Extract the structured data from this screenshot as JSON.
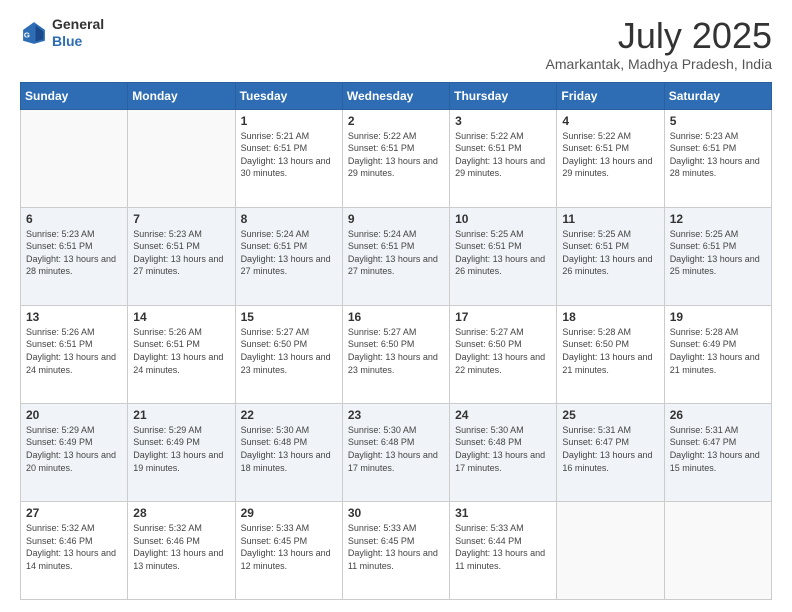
{
  "header": {
    "logo_line1": "General",
    "logo_line2": "Blue",
    "month_title": "July 2025",
    "location": "Amarkantak, Madhya Pradesh, India"
  },
  "days_of_week": [
    "Sunday",
    "Monday",
    "Tuesday",
    "Wednesday",
    "Thursday",
    "Friday",
    "Saturday"
  ],
  "weeks": [
    [
      {
        "day": "",
        "info": ""
      },
      {
        "day": "",
        "info": ""
      },
      {
        "day": "1",
        "info": "Sunrise: 5:21 AM\nSunset: 6:51 PM\nDaylight: 13 hours and 30 minutes."
      },
      {
        "day": "2",
        "info": "Sunrise: 5:22 AM\nSunset: 6:51 PM\nDaylight: 13 hours and 29 minutes."
      },
      {
        "day": "3",
        "info": "Sunrise: 5:22 AM\nSunset: 6:51 PM\nDaylight: 13 hours and 29 minutes."
      },
      {
        "day": "4",
        "info": "Sunrise: 5:22 AM\nSunset: 6:51 PM\nDaylight: 13 hours and 29 minutes."
      },
      {
        "day": "5",
        "info": "Sunrise: 5:23 AM\nSunset: 6:51 PM\nDaylight: 13 hours and 28 minutes."
      }
    ],
    [
      {
        "day": "6",
        "info": "Sunrise: 5:23 AM\nSunset: 6:51 PM\nDaylight: 13 hours and 28 minutes."
      },
      {
        "day": "7",
        "info": "Sunrise: 5:23 AM\nSunset: 6:51 PM\nDaylight: 13 hours and 27 minutes."
      },
      {
        "day": "8",
        "info": "Sunrise: 5:24 AM\nSunset: 6:51 PM\nDaylight: 13 hours and 27 minutes."
      },
      {
        "day": "9",
        "info": "Sunrise: 5:24 AM\nSunset: 6:51 PM\nDaylight: 13 hours and 27 minutes."
      },
      {
        "day": "10",
        "info": "Sunrise: 5:25 AM\nSunset: 6:51 PM\nDaylight: 13 hours and 26 minutes."
      },
      {
        "day": "11",
        "info": "Sunrise: 5:25 AM\nSunset: 6:51 PM\nDaylight: 13 hours and 26 minutes."
      },
      {
        "day": "12",
        "info": "Sunrise: 5:25 AM\nSunset: 6:51 PM\nDaylight: 13 hours and 25 minutes."
      }
    ],
    [
      {
        "day": "13",
        "info": "Sunrise: 5:26 AM\nSunset: 6:51 PM\nDaylight: 13 hours and 24 minutes."
      },
      {
        "day": "14",
        "info": "Sunrise: 5:26 AM\nSunset: 6:51 PM\nDaylight: 13 hours and 24 minutes."
      },
      {
        "day": "15",
        "info": "Sunrise: 5:27 AM\nSunset: 6:50 PM\nDaylight: 13 hours and 23 minutes."
      },
      {
        "day": "16",
        "info": "Sunrise: 5:27 AM\nSunset: 6:50 PM\nDaylight: 13 hours and 23 minutes."
      },
      {
        "day": "17",
        "info": "Sunrise: 5:27 AM\nSunset: 6:50 PM\nDaylight: 13 hours and 22 minutes."
      },
      {
        "day": "18",
        "info": "Sunrise: 5:28 AM\nSunset: 6:50 PM\nDaylight: 13 hours and 21 minutes."
      },
      {
        "day": "19",
        "info": "Sunrise: 5:28 AM\nSunset: 6:49 PM\nDaylight: 13 hours and 21 minutes."
      }
    ],
    [
      {
        "day": "20",
        "info": "Sunrise: 5:29 AM\nSunset: 6:49 PM\nDaylight: 13 hours and 20 minutes."
      },
      {
        "day": "21",
        "info": "Sunrise: 5:29 AM\nSunset: 6:49 PM\nDaylight: 13 hours and 19 minutes."
      },
      {
        "day": "22",
        "info": "Sunrise: 5:30 AM\nSunset: 6:48 PM\nDaylight: 13 hours and 18 minutes."
      },
      {
        "day": "23",
        "info": "Sunrise: 5:30 AM\nSunset: 6:48 PM\nDaylight: 13 hours and 17 minutes."
      },
      {
        "day": "24",
        "info": "Sunrise: 5:30 AM\nSunset: 6:48 PM\nDaylight: 13 hours and 17 minutes."
      },
      {
        "day": "25",
        "info": "Sunrise: 5:31 AM\nSunset: 6:47 PM\nDaylight: 13 hours and 16 minutes."
      },
      {
        "day": "26",
        "info": "Sunrise: 5:31 AM\nSunset: 6:47 PM\nDaylight: 13 hours and 15 minutes."
      }
    ],
    [
      {
        "day": "27",
        "info": "Sunrise: 5:32 AM\nSunset: 6:46 PM\nDaylight: 13 hours and 14 minutes."
      },
      {
        "day": "28",
        "info": "Sunrise: 5:32 AM\nSunset: 6:46 PM\nDaylight: 13 hours and 13 minutes."
      },
      {
        "day": "29",
        "info": "Sunrise: 5:33 AM\nSunset: 6:45 PM\nDaylight: 13 hours and 12 minutes."
      },
      {
        "day": "30",
        "info": "Sunrise: 5:33 AM\nSunset: 6:45 PM\nDaylight: 13 hours and 11 minutes."
      },
      {
        "day": "31",
        "info": "Sunrise: 5:33 AM\nSunset: 6:44 PM\nDaylight: 13 hours and 11 minutes."
      },
      {
        "day": "",
        "info": ""
      },
      {
        "day": "",
        "info": ""
      }
    ]
  ]
}
